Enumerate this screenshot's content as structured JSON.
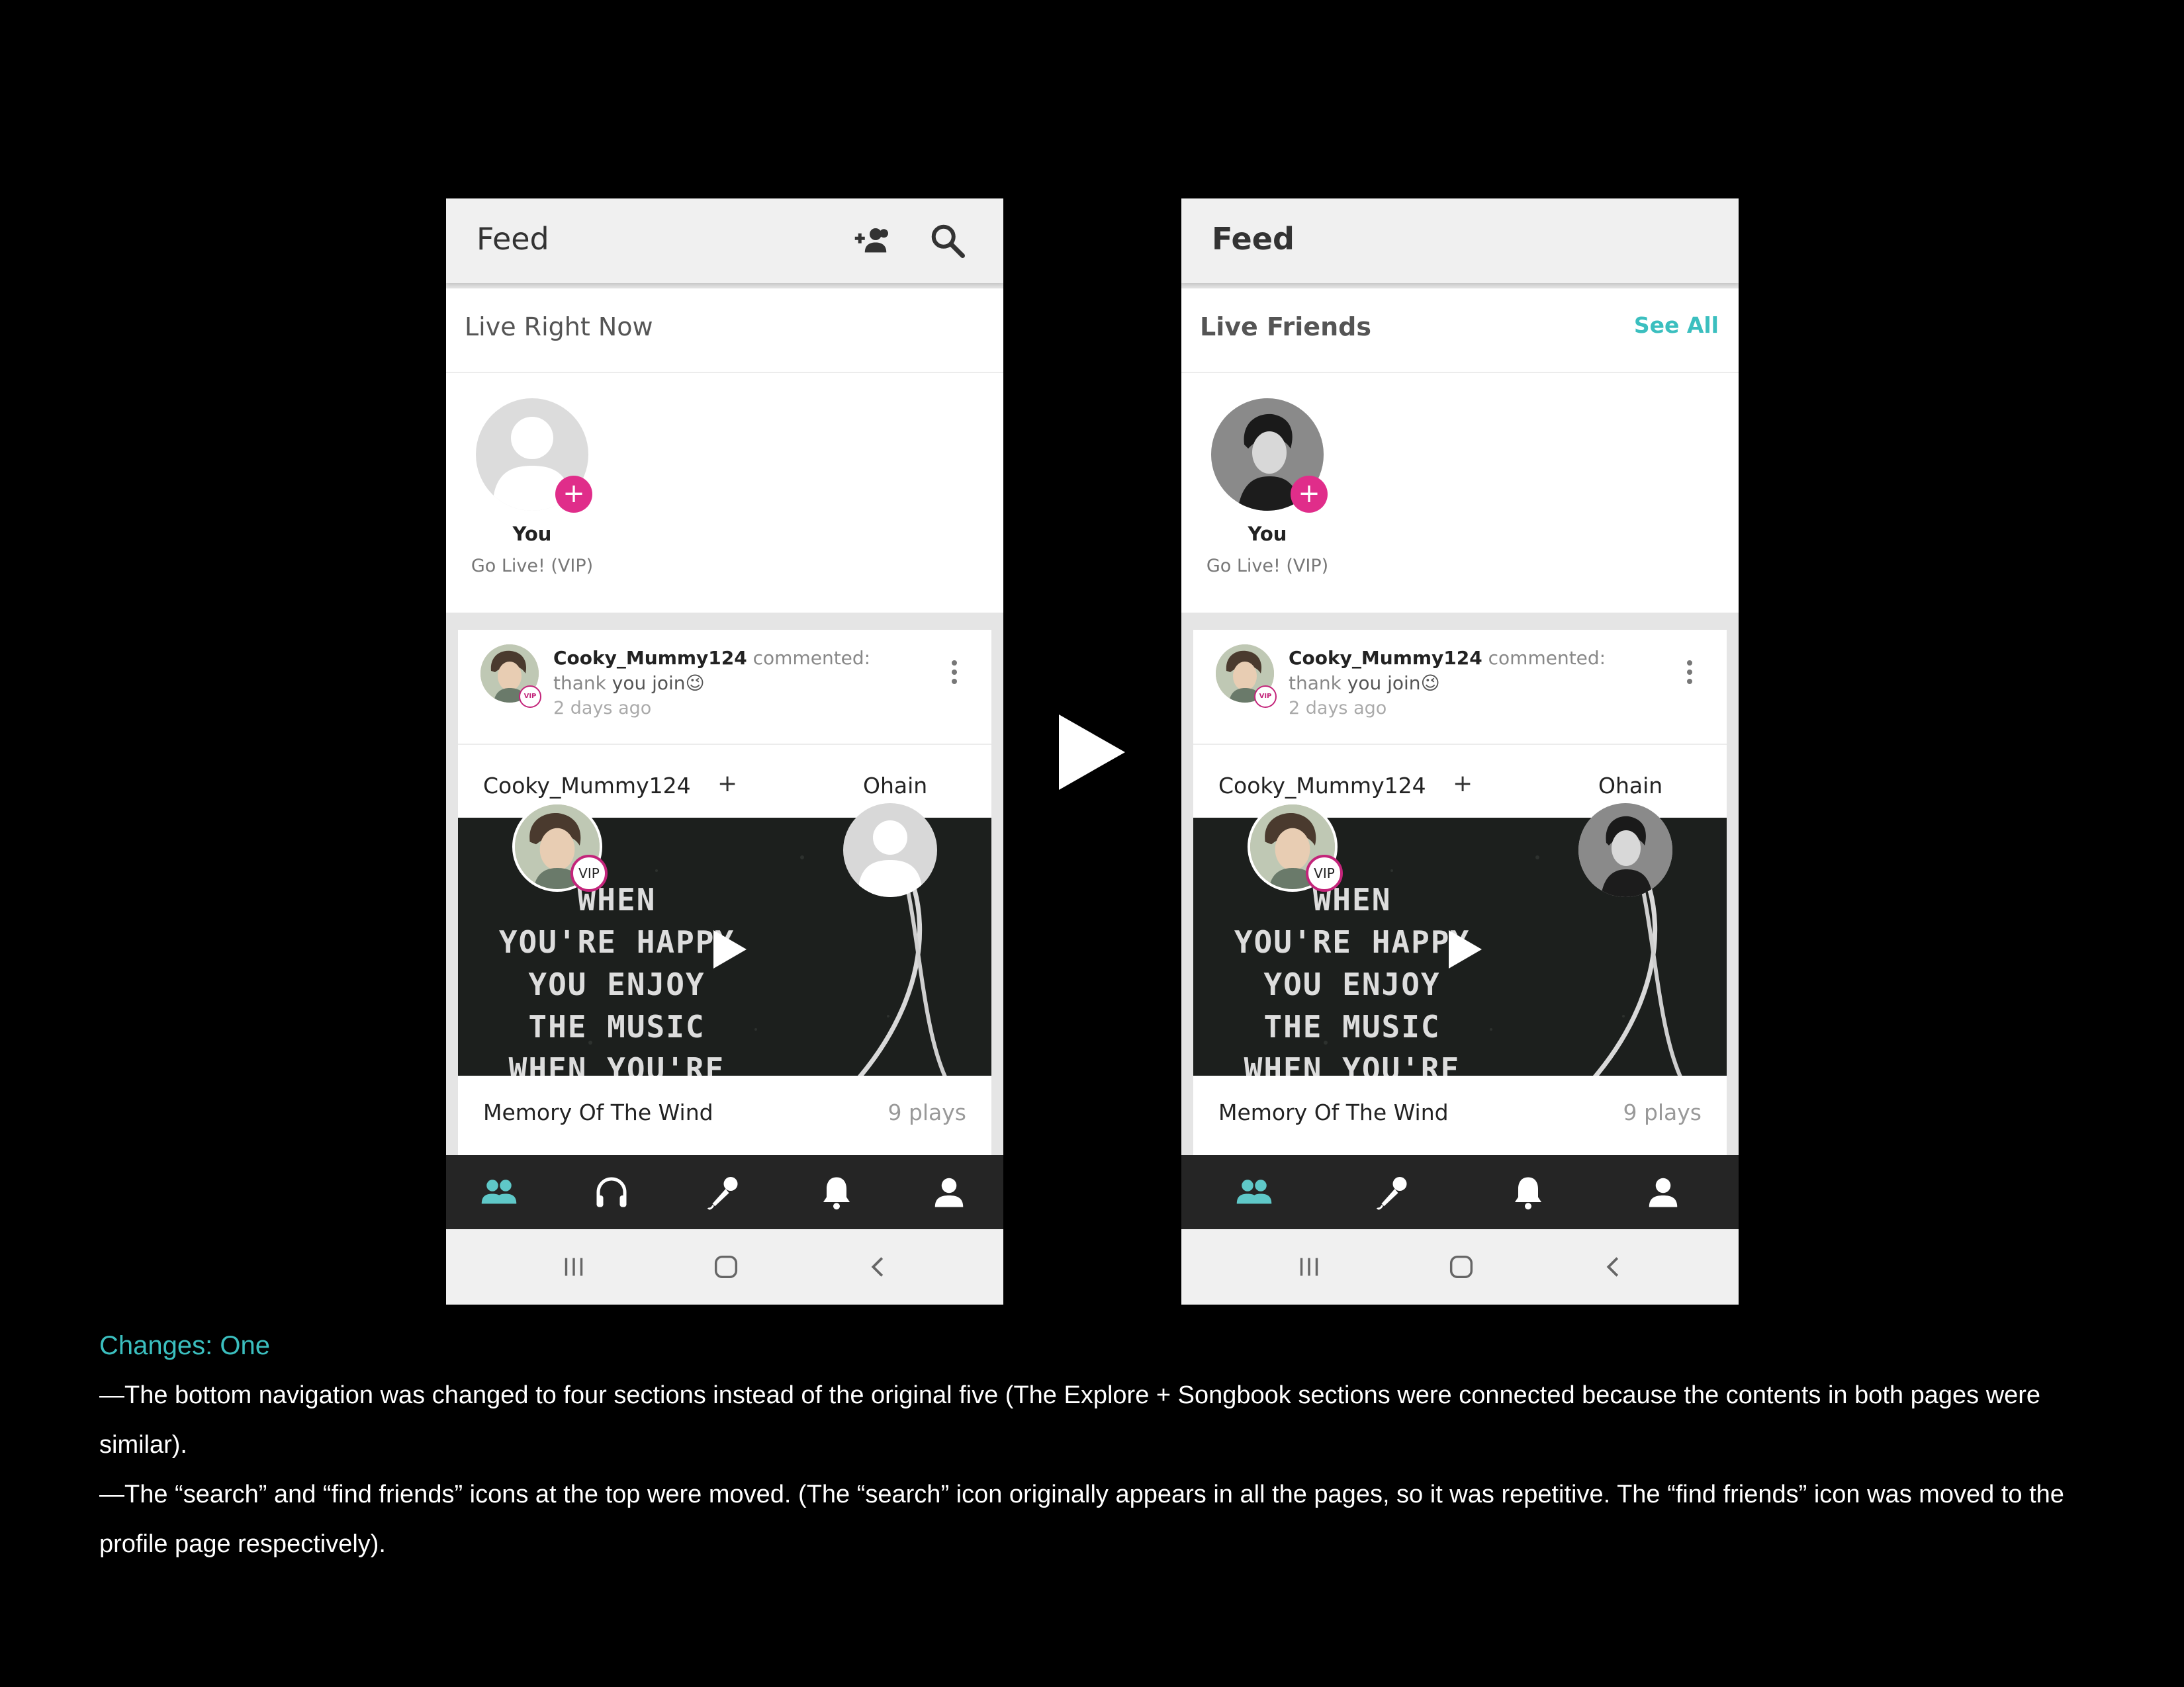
{
  "before": {
    "topbar": {
      "title": "Feed",
      "icons": [
        "add-friends-icon",
        "search-icon"
      ]
    },
    "live": {
      "title": "Live Right Now",
      "you_label": "You",
      "go_live_label": "Go Live! (VIP)",
      "plus": "+"
    },
    "post": {
      "user": "Cooky_Mummy124",
      "comment": "commented: thank",
      "comment_rest": "you join😉",
      "time": "2 days ago",
      "vip_badge": "VIP",
      "duet_user_a": "Cooky_Mummy124",
      "duet_plus": "+",
      "duet_user_b": "Ohain",
      "video_lines": [
        "WHEN",
        "YOU'RE HAPPY",
        "YOU ENJOY",
        "THE MUSIC",
        "WHEN YOU'RE"
      ],
      "song_title": "Memory Of The Wind",
      "plays": "9 plays"
    },
    "nav": [
      "friends-icon",
      "headphones-icon",
      "microphone-icon",
      "bell-icon",
      "profile-icon"
    ]
  },
  "after": {
    "topbar": {
      "title": "Feed"
    },
    "live": {
      "title": "Live Friends",
      "see_all": "See All",
      "you_label": "You",
      "go_live_label": "Go Live! (VIP)",
      "plus": "+"
    },
    "post": {
      "user": "Cooky_Mummy124",
      "comment": "commented: thank",
      "comment_rest": "you join😉",
      "time": "2 days ago",
      "vip_badge": "VIP",
      "duet_user_a": "Cooky_Mummy124",
      "duet_plus": "+",
      "duet_user_b": "Ohain",
      "video_lines": [
        "WHEN",
        "YOU'RE HAPPY",
        "YOU ENJOY",
        "THE MUSIC",
        "WHEN YOU'RE"
      ],
      "song_title": "Memory Of The Wind",
      "plays": "9 plays"
    },
    "nav": [
      "friends-icon",
      "microphone-icon",
      "bell-icon",
      "profile-icon"
    ]
  },
  "system_bar": [
    "recents-icon",
    "home-icon",
    "back-icon"
  ],
  "colors": {
    "accent": "#3bbfbf",
    "pink": "#e02d8a",
    "nav_bg": "#252525",
    "nav_active": "#5fc8c8"
  },
  "changes": {
    "title": "Changes: One",
    "line1": "—The bottom navigation was changed to four sections instead of the original five (The Explore + Songbook sections were connected because the contents in both pages were similar).",
    "line2": "—The “search” and “find friends” icons at the top were moved. (The “search” icon originally appears in all the pages, so it was repetitive. The “find friends” icon was moved to the profile page respectively)."
  }
}
